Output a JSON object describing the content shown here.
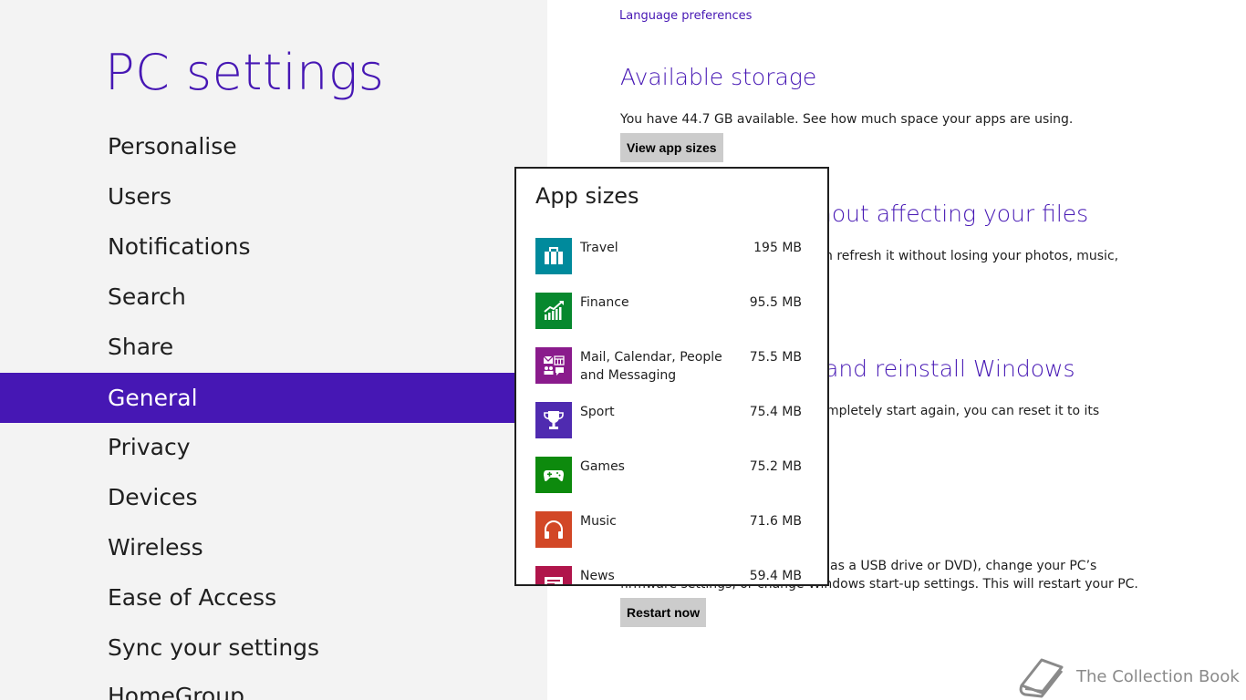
{
  "sidebar": {
    "title": "PC settings",
    "items": [
      {
        "label": "Personalise"
      },
      {
        "label": "Users"
      },
      {
        "label": "Notifications"
      },
      {
        "label": "Search"
      },
      {
        "label": "Share"
      },
      {
        "label": "General",
        "selected": true
      },
      {
        "label": "Privacy"
      },
      {
        "label": "Devices"
      },
      {
        "label": "Wireless"
      },
      {
        "label": "Ease of Access"
      },
      {
        "label": "Sync your settings"
      },
      {
        "label": "HomeGroup"
      }
    ]
  },
  "main": {
    "language_link": "Language preferences",
    "storage": {
      "title": "Available storage",
      "text": "You have 44.7 GB available. See how much space your apps are using.",
      "button": "View app sizes"
    },
    "refresh": {
      "title_partial": "hout affecting your files",
      "text_partial": "n refresh it without losing your photos, music,"
    },
    "reset": {
      "title_partial": "and reinstall Windows",
      "text_partial": "mpletely start again, you can reset it to its"
    },
    "advanced": {
      "text_line1_partial": "as a USB drive or DVD), change your PC’s",
      "text_line2_partial": "firmware settings, or change Windows start-up settings. This will restart your PC.",
      "button": "Restart now"
    }
  },
  "flyout": {
    "title": "App sizes",
    "apps": [
      {
        "name": "Travel",
        "size": "195 MB",
        "icon": "suitcase-icon",
        "color": "#008a9c"
      },
      {
        "name": "Finance",
        "size": "95.5 MB",
        "icon": "chart-growth-icon",
        "color": "#07882e"
      },
      {
        "name": "Mail, Calendar, People and Messaging",
        "size": "75.5 MB",
        "icon": "mail-calendar-people-icon",
        "color": "#8a1b8c"
      },
      {
        "name": "Sport",
        "size": "75.4 MB",
        "icon": "trophy-icon",
        "color": "#4f2bb0"
      },
      {
        "name": "Games",
        "size": "75.2 MB",
        "icon": "gamepad-icon",
        "color": "#0d8a0d"
      },
      {
        "name": "Music",
        "size": "71.6 MB",
        "icon": "headphones-icon",
        "color": "#d24726"
      },
      {
        "name": "News",
        "size": "59.4 MB",
        "icon": "newspaper-icon",
        "color": "#b0154b"
      }
    ]
  },
  "watermark": {
    "text": "The Collection Book",
    "icon": "book-icon"
  }
}
